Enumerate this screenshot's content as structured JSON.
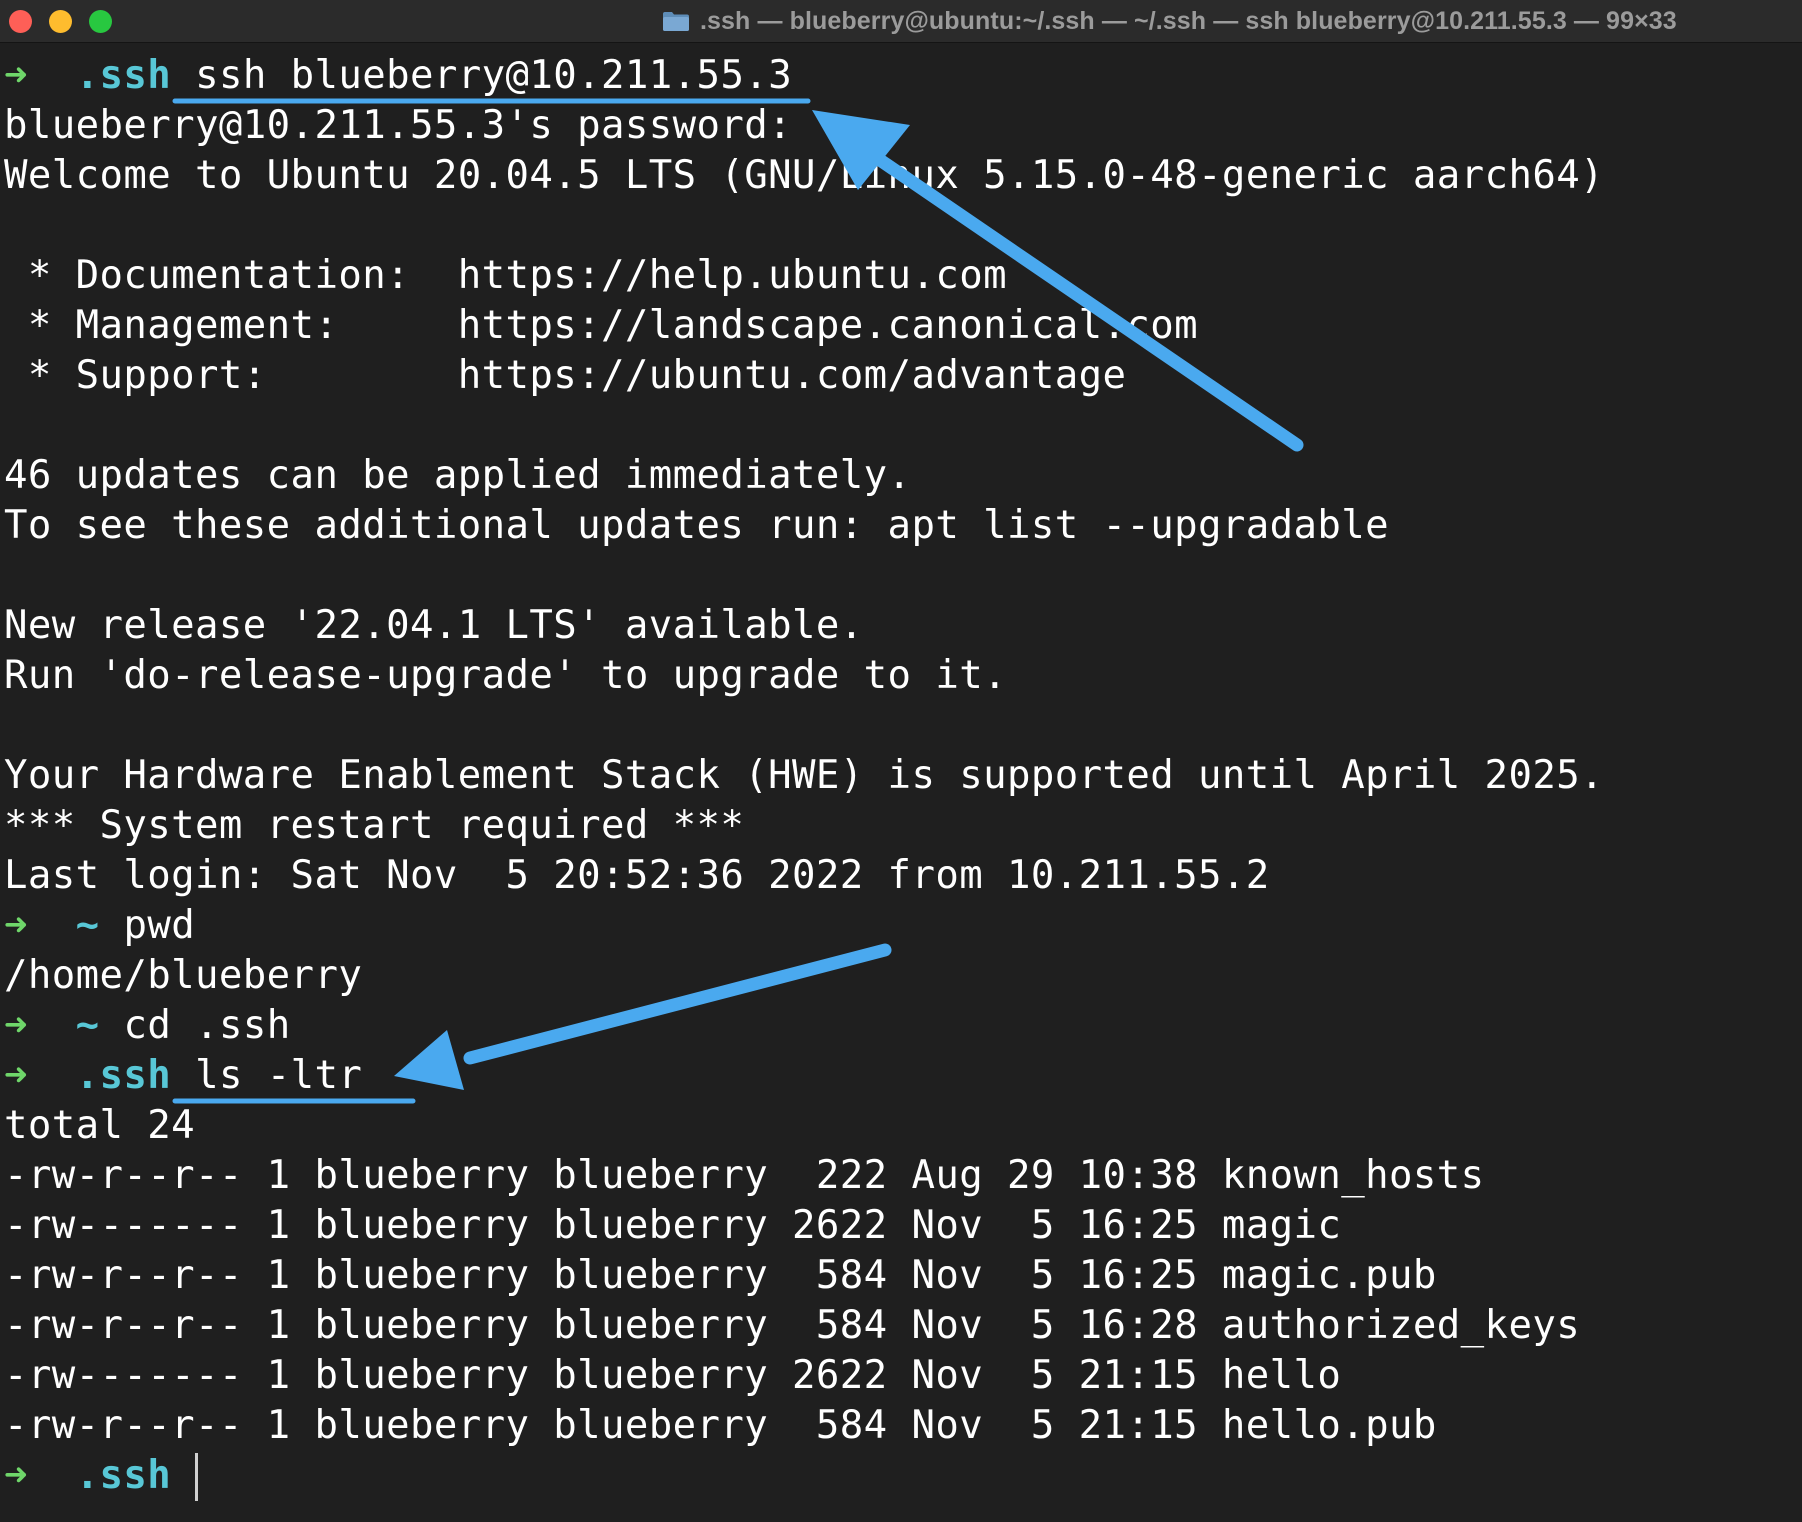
{
  "window": {
    "title": ".ssh — blueberry@ubuntu:~/.ssh — ~/.ssh — ssh blueberry@10.211.55.3 — 99×33",
    "folder_icon": "folder-icon"
  },
  "colors": {
    "background": "#1f1f1f",
    "prompt_arrow": "#6fd66a",
    "prompt_dir": "#58c7d6",
    "text": "#ffffff",
    "annotation": "#4aa9ef"
  },
  "prompts": {
    "arrow": "➜",
    "p1_dir": ".ssh",
    "p1_cmd": "ssh blueberry@10.211.55.3",
    "p2_dir": "~",
    "p2_cmd": "pwd",
    "p3_dir": "~",
    "p3_cmd": "cd .ssh",
    "p4_dir": ".ssh",
    "p4_cmd": "ls -ltr",
    "p5_dir": ".ssh"
  },
  "output": {
    "password_prompt": "blueberry@10.211.55.3's password:",
    "welcome": "Welcome to Ubuntu 20.04.5 LTS (GNU/Linux 5.15.0-48-generic aarch64)",
    "doc": " * Documentation:  https://help.ubuntu.com",
    "mgmt": " * Management:     https://landscape.canonical.com",
    "support": " * Support:        https://ubuntu.com/advantage",
    "updates1": "46 updates can be applied immediately.",
    "updates2": "To see these additional updates run: apt list --upgradable",
    "release1": "New release '22.04.1 LTS' available.",
    "release2": "Run 'do-release-upgrade' to upgrade to it.",
    "hwe": "Your Hardware Enablement Stack (HWE) is supported until April 2025.",
    "restart": "*** System restart required ***",
    "last_login": "Last login: Sat Nov  5 20:52:36 2022 from 10.211.55.2",
    "pwd_output": "/home/blueberry",
    "total": "total 24"
  },
  "listing": [
    "-rw-r--r-- 1 blueberry blueberry  222 Aug 29 10:38 known_hosts",
    "-rw------- 1 blueberry blueberry 2622 Nov  5 16:25 magic",
    "-rw-r--r-- 1 blueberry blueberry  584 Nov  5 16:25 magic.pub",
    "-rw-r--r-- 1 blueberry blueberry  584 Nov  5 16:28 authorized_keys",
    "-rw------- 1 blueberry blueberry 2622 Nov  5 21:15 hello",
    "-rw-r--r-- 1 blueberry blueberry  584 Nov  5 21:15 hello.pub"
  ]
}
